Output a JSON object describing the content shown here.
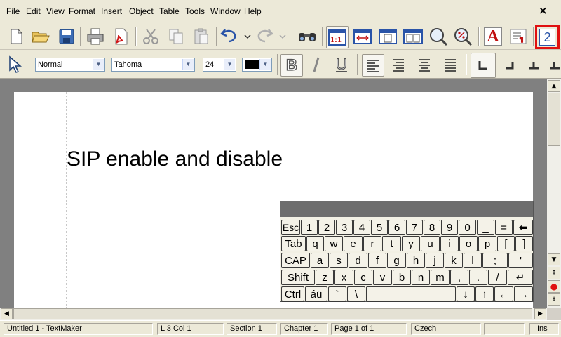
{
  "menu": {
    "items": [
      "File",
      "Edit",
      "View",
      "Format",
      "Insert",
      "Object",
      "Table",
      "Tools",
      "Window",
      "Help"
    ],
    "close_glyph": "×"
  },
  "toolbar1": {
    "buttons": [
      "new-document-icon",
      "open-folder-icon",
      "save-icon",
      "print-icon",
      "export-pdf-icon",
      "cut-icon",
      "copy-icon",
      "paste-icon",
      "undo-icon",
      "redo-icon",
      "find-icon",
      "zoom-100-icon",
      "page-width-icon",
      "full-page-icon",
      "two-pages-icon",
      "zoom-icon",
      "zoom-percent-icon",
      "character-format-icon",
      "paragraph-format-icon",
      "page-number-icon"
    ],
    "zoom_100_label": "1:1",
    "char_format_label": "A",
    "page_number_label": "2",
    "highlight_color": "#e01010"
  },
  "toolbar2": {
    "style": "Normal",
    "font": "Tahoma",
    "size": "24",
    "font_color": "#000000",
    "bold_label": "B",
    "italic_label": "I",
    "underline_label": "U"
  },
  "document": {
    "text": "SIP enable and disable"
  },
  "keyboard": {
    "rows": [
      [
        "Esc",
        "1",
        "2",
        "3",
        "4",
        "5",
        "6",
        "7",
        "8",
        "9",
        "0",
        "_",
        "=",
        "⬅"
      ],
      [
        "Tab",
        "q",
        "w",
        "e",
        "r",
        "t",
        "y",
        "u",
        "i",
        "o",
        "p",
        "[",
        "]"
      ],
      [
        "CAP",
        "a",
        "s",
        "d",
        "f",
        "g",
        "h",
        "j",
        "k",
        "l",
        ";",
        "'"
      ],
      [
        "Shift",
        "z",
        "x",
        "c",
        "v",
        "b",
        "n",
        "m",
        ",",
        ".",
        "/",
        "↵"
      ],
      [
        "Ctrl",
        "áü",
        "`",
        "\\",
        "",
        "↓",
        "↑",
        "←",
        "→"
      ]
    ]
  },
  "status": {
    "file": "Untitled 1 - TextMaker",
    "position": "L 3 Col 1",
    "section": "Section 1",
    "chapter": "Chapter 1",
    "page": "Page 1 of 1",
    "language": "Czech",
    "empty": "",
    "mode": "Ins"
  }
}
